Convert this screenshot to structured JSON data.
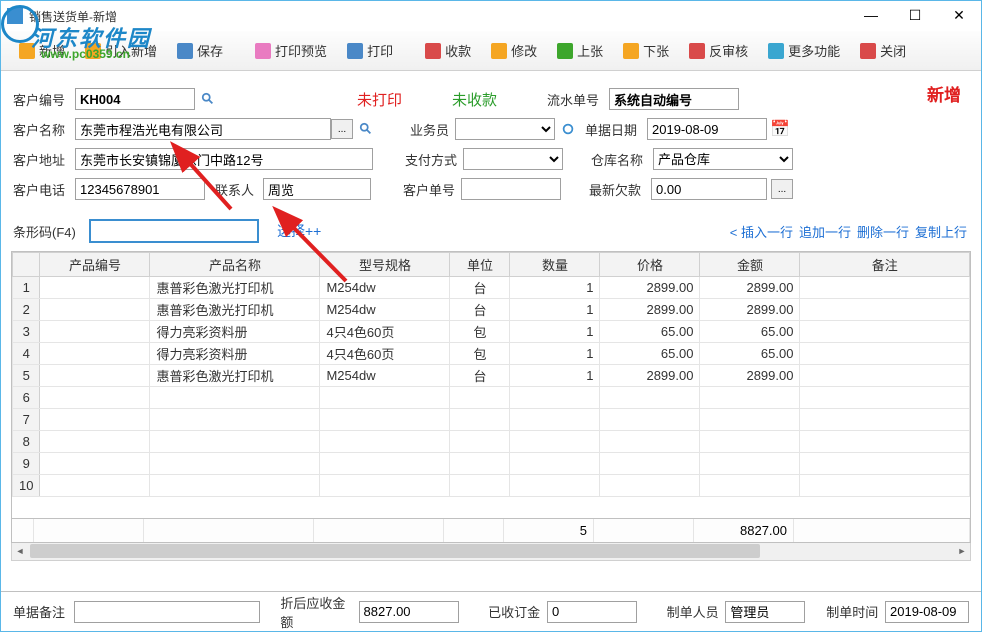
{
  "window": {
    "title": "销售送货单-新增"
  },
  "watermark": {
    "brand": "河东软件园",
    "url": "www.pc0359.cn"
  },
  "toolbar": {
    "new": "新增",
    "import_new": "引入新增",
    "save": "保存",
    "print_preview": "打印预览",
    "print": "打印",
    "receive": "收款",
    "modify": "修改",
    "prev": "上张",
    "next": "下张",
    "unaudit": "反审核",
    "more": "更多功能",
    "close": "关闭"
  },
  "status": {
    "unprinted": "未打印",
    "unpaid": "未收款",
    "mode": "新增"
  },
  "form": {
    "customer_code_label": "客户编号",
    "customer_code": "KH004",
    "customer_name_label": "客户名称",
    "customer_name": "东莞市程浩光电有限公司",
    "customer_addr_label": "客户地址",
    "customer_addr": "东莞市长安镇锦厦东门中路12号",
    "customer_tel_label": "客户电话",
    "customer_tel": "12345678901",
    "contact_label": "联系人",
    "contact": "周览",
    "serial_label": "流水单号",
    "serial": "系统自动编号",
    "date_label": "单据日期",
    "date": "2019-08-09",
    "salesman_label": "业务员",
    "salesman": "",
    "pay_label": "支付方式",
    "pay": "",
    "warehouse_label": "仓库名称",
    "warehouse": "产品仓库",
    "cust_order_label": "客户单号",
    "cust_order": "",
    "latest_debt_label": "最新欠款",
    "latest_debt": "0.00"
  },
  "barcode": {
    "label": "条形码(F4)",
    "value": "",
    "select_link": "选择++"
  },
  "row_ops": {
    "insert": "< 插入一行",
    "append": "追加一行",
    "delete": "删除一行",
    "copy": "复制上行"
  },
  "columns": {
    "product_code": "产品编号",
    "product_name": "产品名称",
    "spec": "型号规格",
    "unit": "单位",
    "qty": "数量",
    "price": "价格",
    "amount": "金额",
    "remark": "备注"
  },
  "rows": [
    {
      "n": 1,
      "code": "",
      "name": "惠普彩色激光打印机",
      "spec": "M254dw",
      "unit": "台",
      "qty": "1",
      "price": "2899.00",
      "amount": "2899.00",
      "remark": ""
    },
    {
      "n": 2,
      "code": "",
      "name": "惠普彩色激光打印机",
      "spec": "M254dw",
      "unit": "台",
      "qty": "1",
      "price": "2899.00",
      "amount": "2899.00",
      "remark": ""
    },
    {
      "n": 3,
      "code": "",
      "name": "得力亮彩资料册",
      "spec": "4只4色60页",
      "unit": "包",
      "qty": "1",
      "price": "65.00",
      "amount": "65.00",
      "remark": ""
    },
    {
      "n": 4,
      "code": "",
      "name": "得力亮彩资料册",
      "spec": "4只4色60页",
      "unit": "包",
      "qty": "1",
      "price": "65.00",
      "amount": "65.00",
      "remark": ""
    },
    {
      "n": 5,
      "code": "",
      "name": "惠普彩色激光打印机",
      "spec": "M254dw",
      "unit": "台",
      "qty": "1",
      "price": "2899.00",
      "amount": "2899.00",
      "remark": ""
    },
    {
      "n": 6,
      "code": "",
      "name": "",
      "spec": "",
      "unit": "",
      "qty": "",
      "price": "",
      "amount": "",
      "remark": ""
    },
    {
      "n": 7,
      "code": "",
      "name": "",
      "spec": "",
      "unit": "",
      "qty": "",
      "price": "",
      "amount": "",
      "remark": ""
    },
    {
      "n": 8,
      "code": "",
      "name": "",
      "spec": "",
      "unit": "",
      "qty": "",
      "price": "",
      "amount": "",
      "remark": ""
    },
    {
      "n": 9,
      "code": "",
      "name": "",
      "spec": "",
      "unit": "",
      "qty": "",
      "price": "",
      "amount": "",
      "remark": ""
    },
    {
      "n": 10,
      "code": "",
      "name": "",
      "spec": "",
      "unit": "",
      "qty": "",
      "price": "",
      "amount": "",
      "remark": ""
    }
  ],
  "totals": {
    "qty": "5",
    "amount": "8827.00"
  },
  "footer": {
    "remark_label": "单据备注",
    "remark": "",
    "discount_label": "折后应收金额",
    "discount": "8827.00",
    "deposit_label": "已收订金",
    "deposit": "0",
    "maker_label": "制单人员",
    "maker": "管理员",
    "make_time_label": "制单时间",
    "make_time": "2019-08-09"
  }
}
